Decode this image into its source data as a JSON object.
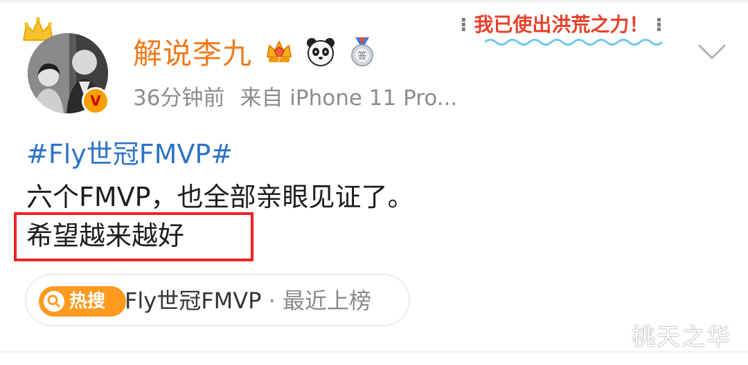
{
  "post": {
    "username": "解说李九",
    "time": "36分钟前",
    "source": "来自 iPhone 11 Pro...",
    "hashtag": "#Fly世冠FMVP#",
    "line1": "六个FMVP，也全部亲眼见证了。",
    "line2": "希望越来越好"
  },
  "slogan": {
    "text": "我已使出洪荒之力！",
    "deco_left": "⁝",
    "deco_right": "⁝"
  },
  "badges": [
    {
      "name": "crown-badge-icon",
      "number": "7"
    },
    {
      "name": "panda-badge-icon"
    },
    {
      "name": "medal-badge-icon",
      "text": "答"
    }
  ],
  "verified": {
    "label": "V"
  },
  "hot_search": {
    "tag_label": "热搜",
    "topic": "Fly世冠FMVP",
    "separator": " · ",
    "status": "最近上榜"
  },
  "watermark": "桃天之华",
  "colors": {
    "username": "#ef7a1a",
    "hashtag": "#2d73c8",
    "highlight_box": "#ee2222",
    "hot_tag": "#ff9a1f"
  }
}
